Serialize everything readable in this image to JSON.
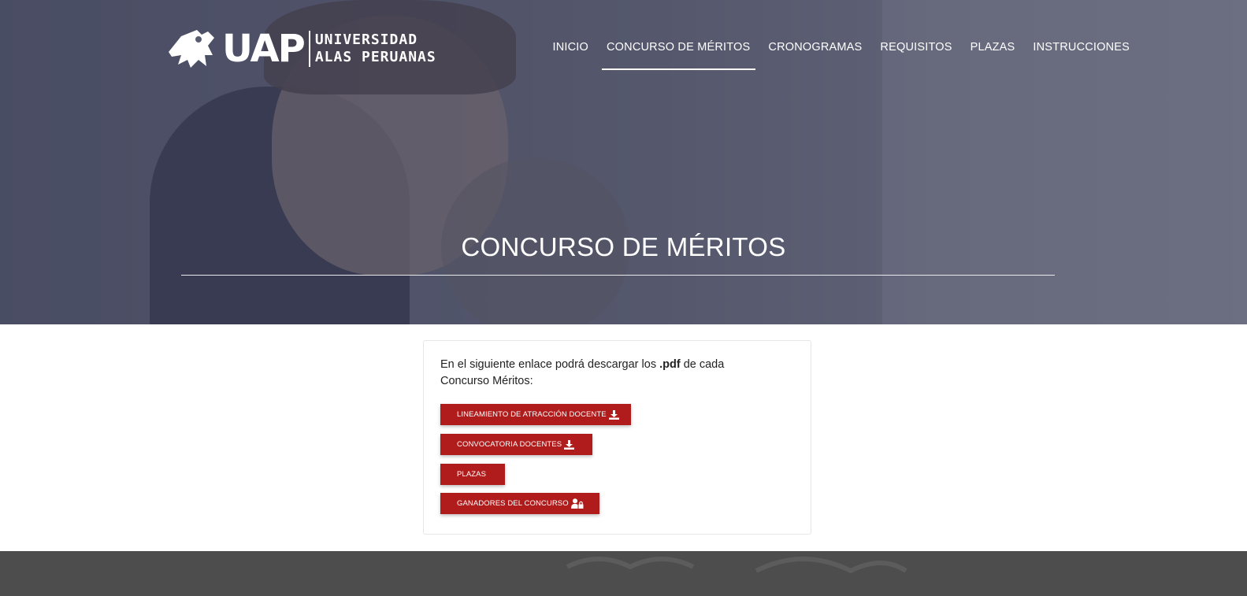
{
  "header": {
    "logo_abbr": "UAP",
    "logo_name_line1": "UNIVERSIDAD",
    "logo_name_line2": "ALAS PERUANAS"
  },
  "nav": {
    "items": [
      {
        "label": "INICIO",
        "active": false
      },
      {
        "label": "CONCURSO DE MÉRITOS",
        "active": true
      },
      {
        "label": "CRONOGRAMAS",
        "active": false
      },
      {
        "label": "REQUISITOS",
        "active": false
      },
      {
        "label": "PLAZAS",
        "active": false
      },
      {
        "label": "INSTRUCCIONES",
        "active": false
      }
    ]
  },
  "hero": {
    "title": "CONCURSO DE MÉRITOS"
  },
  "card": {
    "intro_before": "En el siguiente enlace podrá descargar los ",
    "intro_bold": ".pdf",
    "intro_after": " de cada Concurso Méritos:",
    "buttons": [
      {
        "label": "LINEAMIENTO DE ATRACCIÓN DOCENTE",
        "icon": "download-icon"
      },
      {
        "label": "CONVOCATORIA DOCENTES",
        "icon": "download-icon"
      },
      {
        "label": "PLAZAS",
        "icon": ""
      },
      {
        "label": "GANADORES DEL CONCURSO",
        "icon": "user-lock-icon"
      }
    ]
  },
  "colors": {
    "button_bg": "#b01c1c",
    "footer_bg": "#4d4d4d",
    "hero_overlay": "#3c3e56"
  }
}
